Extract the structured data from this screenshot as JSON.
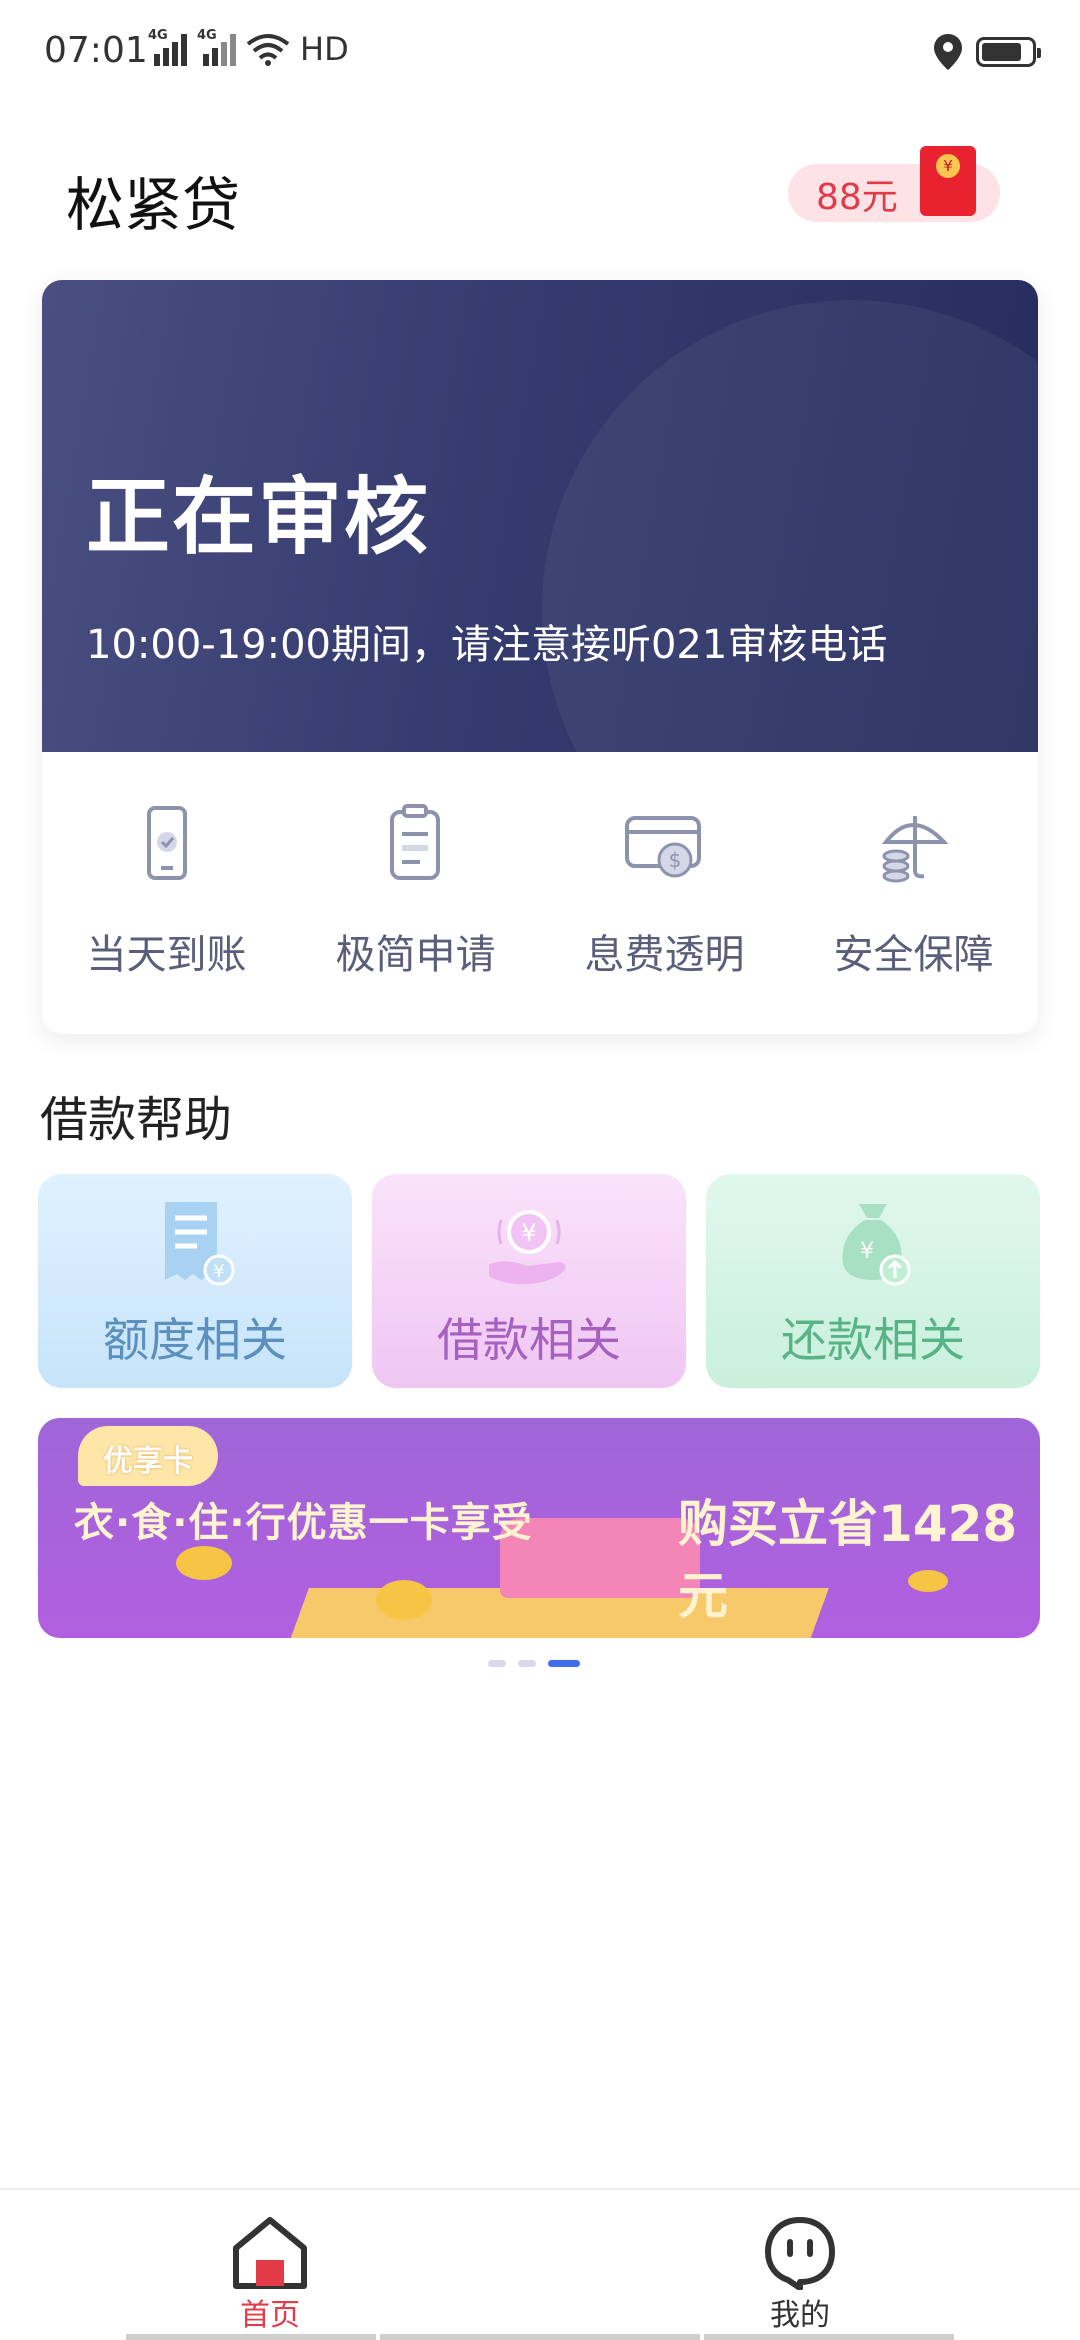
{
  "status_bar": {
    "time": "07:01",
    "network1": "4G",
    "network2": "4G",
    "hd": "HD"
  },
  "header": {
    "title": "松紧贷",
    "red_packet_amount": "88元",
    "red_packet_coin": "¥"
  },
  "review": {
    "title": "正在审核",
    "subtitle": "10:00-19:00期间，请注意接听021审核电话",
    "features": [
      {
        "label": "当天到账",
        "icon": "phone-check-icon"
      },
      {
        "label": "极简申请",
        "icon": "document-icon"
      },
      {
        "label": "息费透明",
        "icon": "card-dollar-icon"
      },
      {
        "label": "安全保障",
        "icon": "umbrella-coins-icon"
      }
    ]
  },
  "help": {
    "title": "借款帮助",
    "cards": [
      {
        "label": "额度相关",
        "icon": "receipt-yuan-icon"
      },
      {
        "label": "借款相关",
        "icon": "hand-yuan-icon"
      },
      {
        "label": "还款相关",
        "icon": "money-bag-icon"
      }
    ]
  },
  "promo": {
    "badge": "优享卡",
    "tagline": "衣·食·住·行优惠一卡享受",
    "saving": "购买立省1428元",
    "slides": 3,
    "active_slide": 3
  },
  "tabbar": {
    "tabs": [
      {
        "label": "首页",
        "icon": "home-icon",
        "active": true
      },
      {
        "label": "我的",
        "icon": "profile-face-icon",
        "active": false
      }
    ]
  },
  "colors": {
    "accent": "#e23b47",
    "banner": "#2f3566",
    "dot_active": "#3f6ee8"
  }
}
